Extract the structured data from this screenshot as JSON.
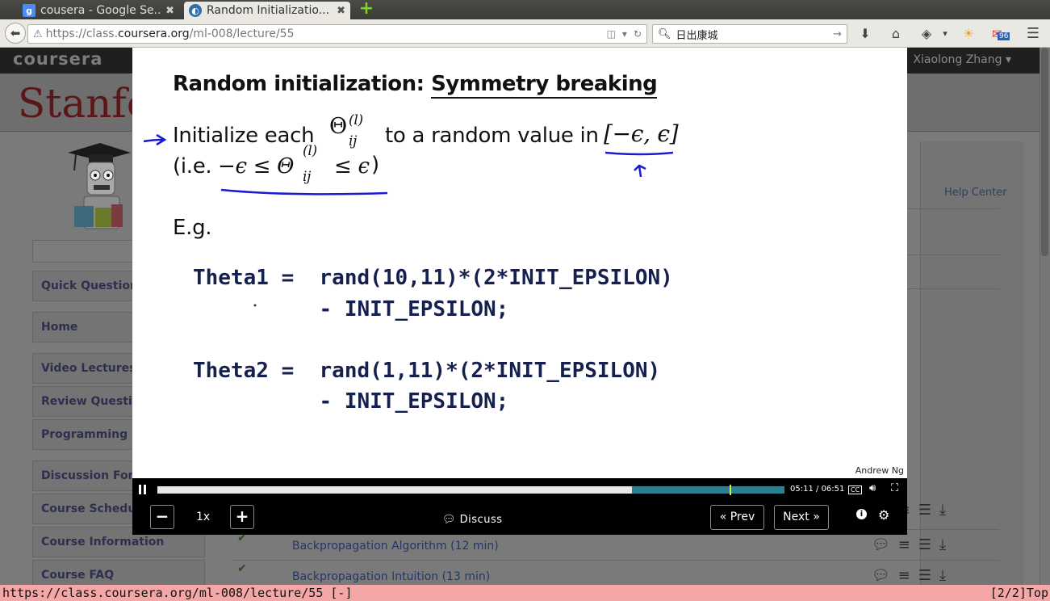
{
  "browser": {
    "tabs": [
      {
        "label": "cousera - Google Se...",
        "favicon": "g",
        "close": "✖"
      },
      {
        "label": "Random Initializatio...",
        "close": "✖"
      }
    ],
    "new_tab_symbol": "+",
    "url_scheme": "https://class.",
    "url_domain": "coursera.org",
    "url_path": "/ml-008/lecture/55",
    "search_query": "日出康城",
    "badge_count": "96"
  },
  "site": {
    "logo": "coursera",
    "user": "Xiaolong Zhang ▾",
    "university": "Stanford",
    "help_center": "Help Center",
    "nav": [
      "Quick Questions",
      "Home",
      "Video Lectures",
      "Review Questions",
      "Programming Exercises",
      "Discussion Forums",
      "Course Schedule",
      "Course Information",
      "Course FAQ"
    ],
    "lectures": [
      {
        "title": "Backpropagation Algorithm (12 min)"
      },
      {
        "title": "Backpropagation Intuition (13 min)"
      }
    ]
  },
  "slide": {
    "title_plain": "Random initialization: ",
    "title_underlined": "Symmetry breaking",
    "bullet_pre": "Initialize each",
    "bullet_mid": "to a random value in",
    "bullet_interval": "[−ϵ, ϵ]",
    "paren_open": "(i.e.",
    "paren_ineq": "−ϵ ≤ Θ",
    "paren_tail": "≤ ϵ",
    "paren_close": ")",
    "theta_symbol": "Θ",
    "superscript": "(l)",
    "subscript": "ij",
    "eg": "E.g.",
    "code_line1": "Theta1 =  rand(10,11)*(2*INIT_EPSILON)",
    "code_line2": "          - INIT_EPSILON;",
    "code_line3": "Theta2 =  rand(1,11)*(2*INIT_EPSILON)",
    "code_line4": "          - INIT_EPSILON;",
    "credit": "Andrew Ng"
  },
  "player": {
    "progress_fraction": 0.757,
    "marker_fraction": 0.912,
    "time_current": "05:11",
    "time_total": "06:51",
    "cc_label": "CC",
    "speed": "1x",
    "minus": "−",
    "plus": "+",
    "discuss": "Discuss",
    "prev": "« Prev",
    "next": "Next »",
    "info": "i"
  },
  "statusline": {
    "left": "https://class.coursera.org/ml-008/lecture/55 [-]",
    "right": "[2/2]Top"
  },
  "colors": {
    "slide_code": "#15204e",
    "progress_buffer": "#2d7f92",
    "status_bar": "#f5a7a7",
    "ink_annotation": "#1a1ad0"
  }
}
